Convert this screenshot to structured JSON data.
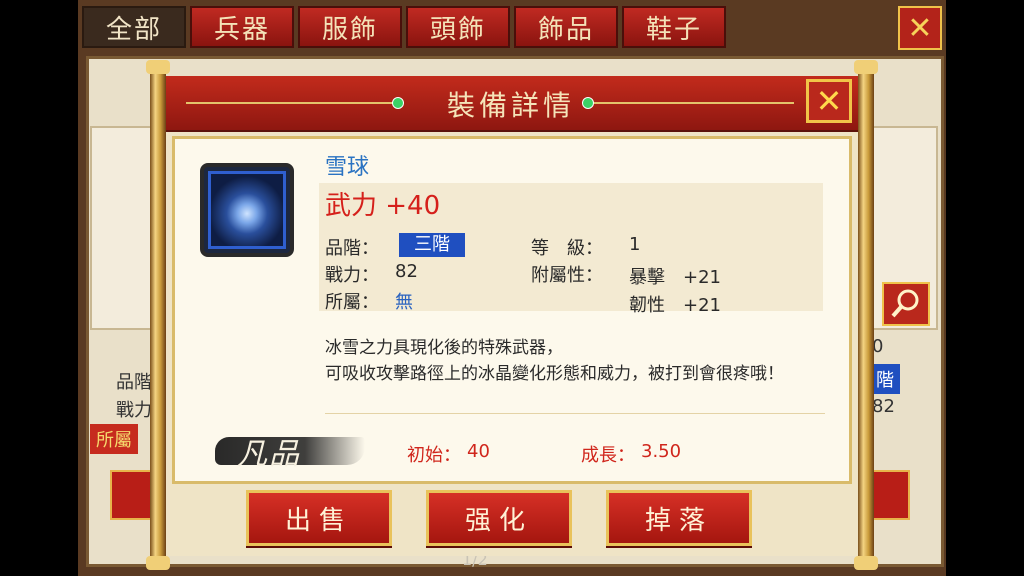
{
  "tabs": [
    "全部",
    "兵器",
    "服飾",
    "頭飾",
    "飾品",
    "鞋子"
  ],
  "background": {
    "left_text": [
      "品階",
      "戰力",
      "所屬"
    ],
    "right_text": [
      "階",
      "82",
      "0"
    ],
    "page_indicator": "1/2"
  },
  "icons": {
    "bg_close": "close-icon",
    "modal_close": "close-icon",
    "search": "magnifier-icon"
  },
  "modal": {
    "title": "裝備詳情",
    "close_glyph": "✕",
    "item": {
      "name": "雪球",
      "main_attr": "武力 +40",
      "quality_label": "品階：",
      "quality_value": "三階",
      "power_label": "戰力：",
      "power_value": "82",
      "owner_label": "所屬：",
      "owner_value": "無",
      "level_label": "等　級：",
      "level_value": "1",
      "extra_label": "附屬性：",
      "extra_1": "暴擊　+21",
      "extra_2": "韌性　+21",
      "description_1": "冰雪之力具現化後的特殊武器，",
      "description_2": "可吸收攻擊路徑上的冰晶變化形態和威力，被打到會很疼哦！",
      "grade": "凡品",
      "initial_label": "初始：",
      "initial_value": "40",
      "growth_label": "成長：",
      "growth_value": "3.50"
    },
    "buttons": {
      "sell": "出售",
      "enhance": "强化",
      "drop": "掉落"
    }
  },
  "colors": {
    "header_red": "#b3221a",
    "gold": "#e9c25a",
    "attr_red": "#d5201b",
    "name_blue": "#2a73c2",
    "badge_blue": "#1f4fc0"
  }
}
